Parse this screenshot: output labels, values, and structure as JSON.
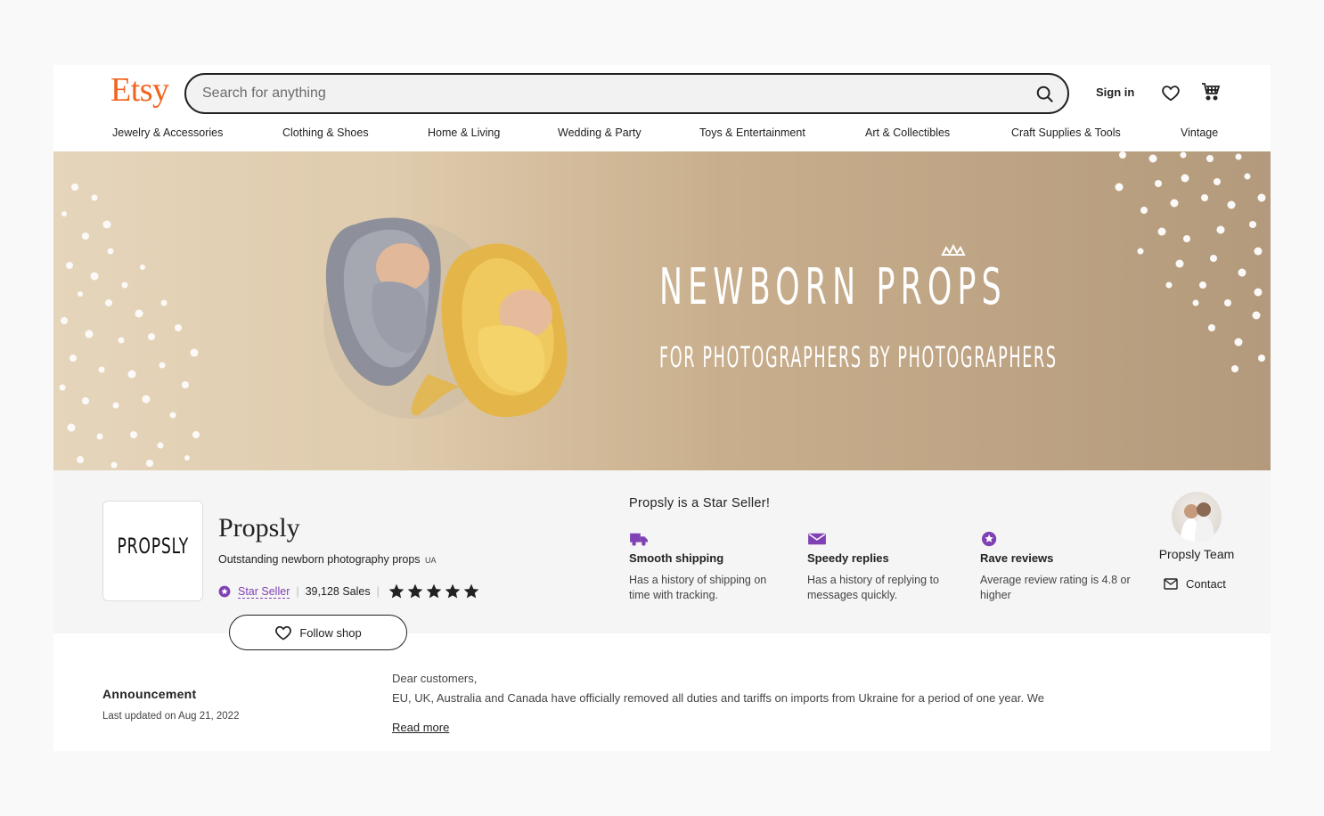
{
  "header": {
    "logo": "Etsy",
    "search_placeholder": "Search for anything",
    "sign_in": "Sign in",
    "icons": {
      "search": "search-icon",
      "favorites": "heart-icon",
      "cart": "cart-icon"
    }
  },
  "categories": [
    "Jewelry & Accessories",
    "Clothing & Shoes",
    "Home & Living",
    "Wedding & Party",
    "Toys & Entertainment",
    "Art & Collectibles",
    "Craft Supplies & Tools",
    "Vintage"
  ],
  "banner": {
    "title": "NEWBORN PROPS",
    "subtitle": "FOR PHOTOGRAPHERS BY PHOTOGRAPHERS"
  },
  "shop": {
    "logo_text": "PROPSLY",
    "name": "Propsly",
    "tagline": "Outstanding newborn photography props",
    "country": "UA",
    "badge": "Star Seller",
    "sales": "39,128 Sales",
    "rating_stars": 5,
    "follow_label": "Follow shop"
  },
  "star_seller": {
    "heading": "Propsly is a Star Seller!",
    "perks": [
      {
        "icon": "truck-icon",
        "title": "Smooth shipping",
        "desc": "Has a history of shipping on time with tracking."
      },
      {
        "icon": "envelope-icon",
        "title": "Speedy replies",
        "desc": "Has a history of replying to messages quickly."
      },
      {
        "icon": "star-badge-icon",
        "title": "Rave reviews",
        "desc": "Average review rating is 4.8 or higher"
      }
    ]
  },
  "owner": {
    "name": "Propsly Team",
    "contact": "Contact"
  },
  "announcement": {
    "title": "Announcement",
    "updated": "Last updated on Aug 21, 2022",
    "line1": "Dear customers,",
    "line2": "EU, UK, Australia and Canada have officially removed all duties and tariffs on imports from Ukraine for a period of one year. We",
    "read_more": "Read more"
  },
  "colors": {
    "brand": "#F1641E",
    "star_seller": "#7f41b3",
    "banner_bg": "#c8ae8c"
  }
}
